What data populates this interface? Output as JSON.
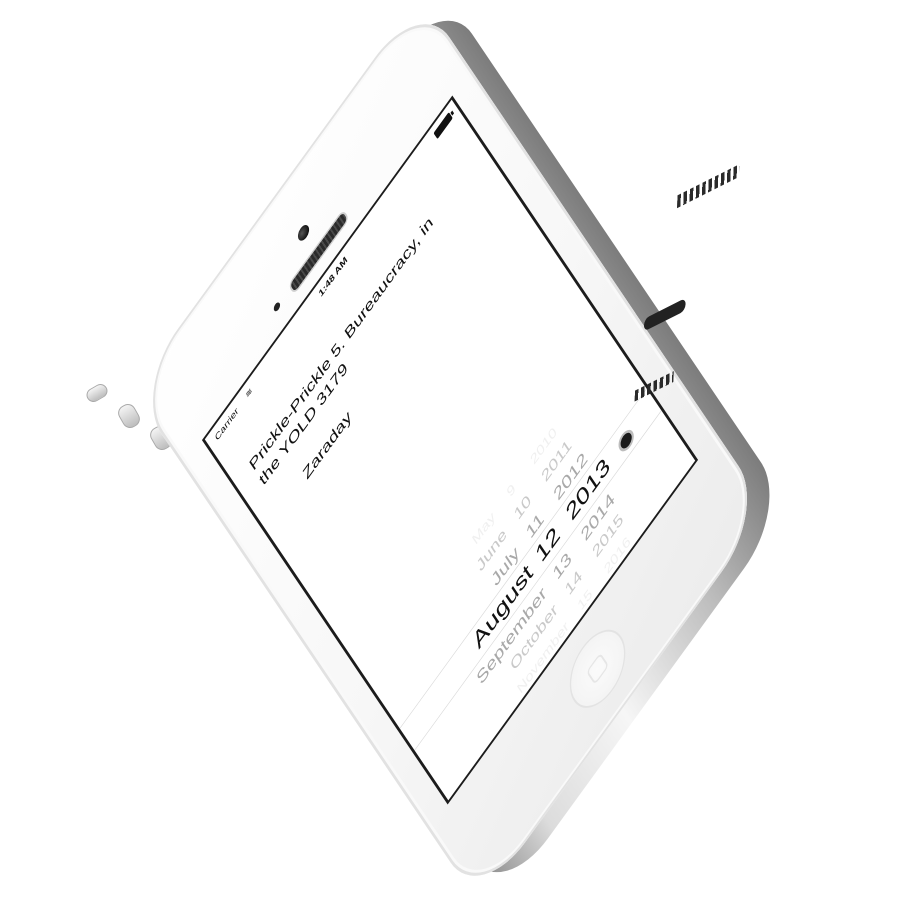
{
  "status_bar": {
    "carrier": "Carrier",
    "time": "1:48 AM",
    "wifi_icon": "wifi-icon",
    "battery_icon": "battery-full-icon"
  },
  "content": {
    "message_line1": "Prickle-Prickle 5. Bureaucracy, in",
    "message_line2": "the YOLD 3179",
    "date_label": "Zaraday"
  },
  "date_picker": {
    "months": [
      "May",
      "June",
      "July",
      "August",
      "September",
      "October",
      "November"
    ],
    "days": [
      "9",
      "10",
      "11",
      "12",
      "13",
      "14",
      "15"
    ],
    "years": [
      "2010",
      "2011",
      "2012",
      "2013",
      "2014",
      "2015",
      "2016"
    ],
    "selected_month": "August",
    "selected_day": "12",
    "selected_year": "2013"
  },
  "device": {
    "model": "",
    "color": "#f5f5f5"
  }
}
